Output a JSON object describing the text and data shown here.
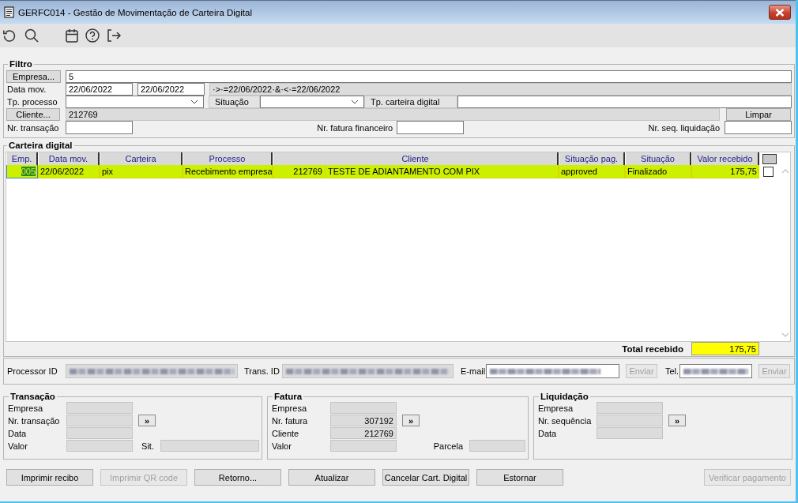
{
  "window": {
    "title": "GERFC014 - Gestão de Movimentação de Carteira Digital"
  },
  "filter": {
    "title": "Filtro",
    "empresa": {
      "button": "Empresa...",
      "value": "5"
    },
    "data_mov": {
      "label": "Data mov.",
      "from": "22/06/2022",
      "to": "22/06/2022",
      "expression": "·>·=22/06/2022·&·<·=22/06/2022"
    },
    "tp_processo": {
      "label": "Tp. processo"
    },
    "situacao": {
      "label": "Situação"
    },
    "tp_carteira_digital": {
      "label": "Tp. carteira digital"
    },
    "cliente": {
      "button": "Cliente...",
      "value": "212769"
    },
    "clear_button": "Limpar",
    "nr_transacao": {
      "label": "Nr. transação"
    },
    "nr_fatura_financeiro": {
      "label": "Nr. fatura financeiro"
    },
    "nr_seq_liquidacao": {
      "label": "Nr. seq. liquidação"
    }
  },
  "wallet": {
    "title": "Carteira digital",
    "columns": [
      "Emp.",
      "Data mov.",
      "Carteira",
      "Processo",
      "Cliente",
      "Situação pag.",
      "Situação",
      "Valor recebido"
    ],
    "select_all": {
      "checked": false
    },
    "rows": [
      {
        "selected": true,
        "checked": false,
        "emp": "005",
        "data_mov": "22/06/2022",
        "carteira": "pix",
        "processo": "Recebimento empresa",
        "cliente_code": "212769",
        "cliente_name": "TESTE DE ADIANTAMENTO COM PIX",
        "situacao_pag": "approved",
        "situacao": "Finalizado",
        "valor_recebido": "175,75"
      }
    ],
    "total": {
      "label": "Total recebido",
      "value": "175,75"
    }
  },
  "details": {
    "processor_id": {
      "label": "Processor ID",
      "blurred": true
    },
    "trans_id": {
      "label": "Trans. ID",
      "blurred": true
    },
    "email": {
      "label": "E-mail",
      "blurred": true,
      "button": {
        "label": "Enviar",
        "disabled": true
      }
    },
    "tel": {
      "label": "Tel.",
      "blurred": true,
      "button": {
        "label": "Enviar",
        "disabled": true
      }
    }
  },
  "groups": [
    {
      "title": "Transação",
      "fields": [
        {
          "label": "Empresa"
        },
        {
          "label": "Nr. transação",
          "button": "»"
        },
        {
          "label": "Data"
        },
        {
          "label": "Valor",
          "extra": {
            "label": "Sit."
          }
        }
      ]
    },
    {
      "title": "Fatura",
      "fields": [
        {
          "label": "Empresa"
        },
        {
          "label": "Nr. fatura",
          "value": "307192",
          "button": "»"
        },
        {
          "label": "Cliente",
          "value": "212769"
        },
        {
          "label": "Valor",
          "extra": {
            "label": "Parcela"
          }
        }
      ]
    },
    {
      "title": "Liquidação",
      "fields": [
        {
          "label": "Empresa"
        },
        {
          "label": "Nr. sequência",
          "button": "»"
        },
        {
          "label": "Data"
        }
      ]
    }
  ],
  "actions": [
    {
      "label": "Imprimir recibo",
      "disabled": false
    },
    {
      "label": "Imprimir QR code",
      "disabled": true
    },
    {
      "label": "Retorno...",
      "disabled": false
    },
    {
      "label": "Atualizar",
      "disabled": false
    },
    {
      "label": "Cancelar Cart. Digital",
      "disabled": false
    },
    {
      "label": "Estornar",
      "disabled": false
    }
  ],
  "verify_button": {
    "label": "Verificar pagamento",
    "disabled": true
  }
}
